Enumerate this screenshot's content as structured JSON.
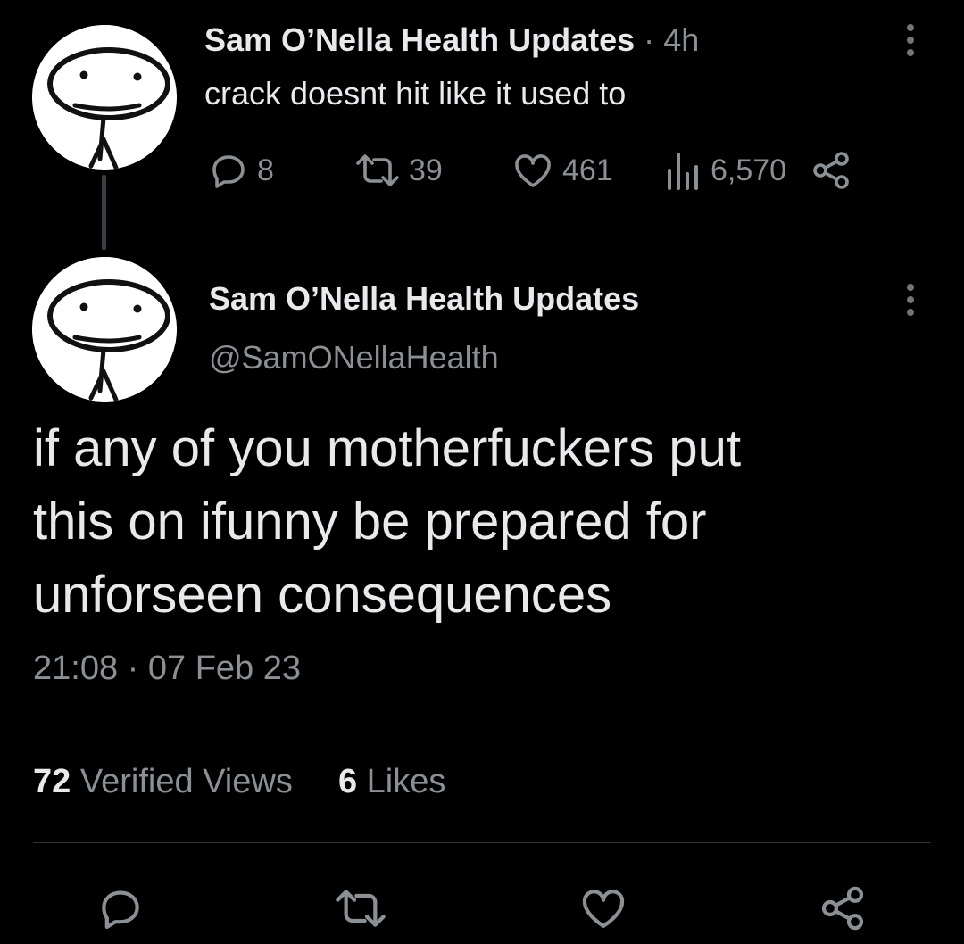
{
  "reply": {
    "author_name": "Sam O’Nella Health Updates",
    "separator": "·",
    "time_ago": "4h",
    "text": "crack doesnt hit like it used to",
    "actions": {
      "replies": "8",
      "retweets": "39",
      "likes": "461",
      "views": "6,570"
    }
  },
  "main_tweet": {
    "author_name": "Sam O’Nella Health Updates",
    "handle": "@SamONellaHealth",
    "text_lines": [
      "if any of you motherfuckers put",
      "this on ifunny be prepared for",
      "unforseen consequences"
    ],
    "time": "21:08",
    "separator": "·",
    "date": "07 Feb 23",
    "stats": {
      "views_count": "72",
      "views_label": "Verified Views",
      "likes_count": "6",
      "likes_label": "Likes"
    }
  },
  "icons": {
    "reply": "reply-icon",
    "retweet": "retweet-icon",
    "like": "heart-icon",
    "views": "views-icon",
    "share": "share-icon",
    "more": "more-icon"
  },
  "colors": {
    "background": "#000000",
    "text": "#e7e9ea",
    "muted": "#71767b",
    "divider": "#2f3336"
  }
}
